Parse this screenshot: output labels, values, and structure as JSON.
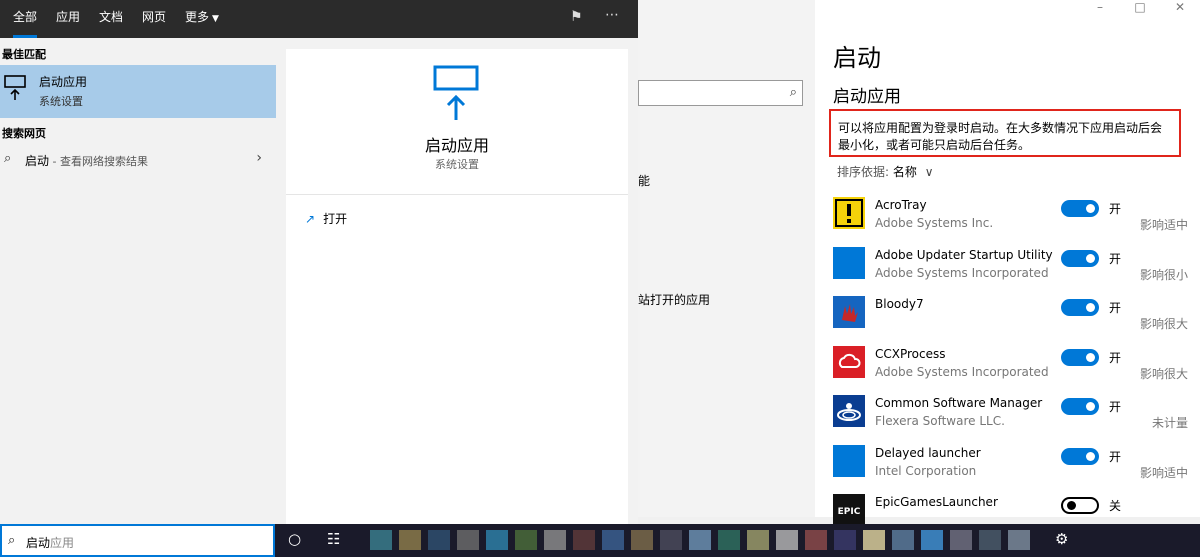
{
  "start": {
    "tabs": [
      {
        "label": "全部"
      },
      {
        "label": "应用"
      },
      {
        "label": "文档"
      },
      {
        "label": "网页"
      },
      {
        "label": "更多"
      }
    ],
    "best_match_heading": "最佳匹配",
    "best_match": {
      "name": "启动应用",
      "subtitle": "系统设置"
    },
    "web_heading": "搜索网页",
    "web_item": {
      "query": "启动",
      "suffix": " - 查看网络搜索结果"
    },
    "detail": {
      "title": "启动应用",
      "subtitle": "系统设置",
      "open_label": "打开"
    }
  },
  "background": {
    "frag1": "能",
    "frag2": "站打开的应用"
  },
  "settings": {
    "title": "启动",
    "subtitle": "启动应用",
    "description": "可以将应用配置为登录时启动。在大多数情况下应用启动后会最小化，或者可能只启动后台任务。",
    "sort_label": "排序依据:",
    "sort_value": "名称",
    "on_label": "开",
    "off_label": "关",
    "apps": [
      {
        "name": "AcroTray",
        "publisher": "Adobe Systems Inc.",
        "enabled": true,
        "impact": "影响适中",
        "icon": "acrotray-icon"
      },
      {
        "name": "Adobe Updater Startup Utility",
        "publisher": "Adobe Systems Incorporated",
        "enabled": true,
        "impact": "影响很小",
        "icon": "blank-app-icon"
      },
      {
        "name": "Bloody7",
        "publisher": "",
        "enabled": true,
        "impact": "影响很大",
        "icon": "bloody-icon"
      },
      {
        "name": "CCXProcess",
        "publisher": "Adobe Systems Incorporated",
        "enabled": true,
        "impact": "影响很大",
        "icon": "creative-cloud-icon"
      },
      {
        "name": "Common Software Manager",
        "publisher": "Flexera Software LLC.",
        "enabled": true,
        "impact": "未计量",
        "icon": "flexera-icon"
      },
      {
        "name": "Delayed launcher",
        "publisher": "Intel Corporation",
        "enabled": true,
        "impact": "影响适中",
        "icon": "blank-app-icon"
      },
      {
        "name": "EpicGamesLauncher",
        "publisher": "",
        "enabled": false,
        "impact": "",
        "icon": "epic-icon"
      }
    ]
  },
  "taskbar": {
    "query_typed": "启动",
    "query_hint": "应用"
  },
  "colors": {
    "accent": "#0078d7",
    "highlight": "#a7cbe9",
    "annotation": "#e0251b"
  }
}
